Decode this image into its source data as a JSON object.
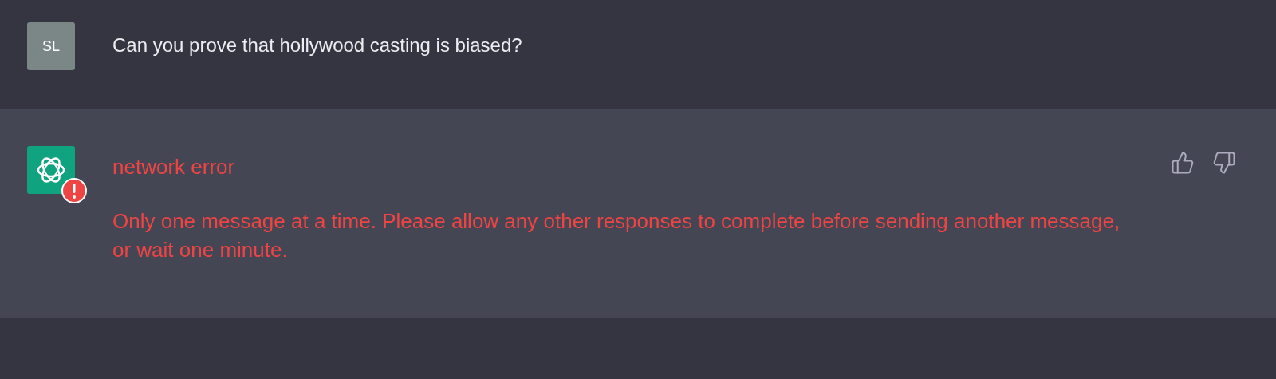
{
  "user_message": {
    "avatar": "SL",
    "text": "Can you prove that hollywood casting is biased?"
  },
  "assistant_message": {
    "error": true,
    "title": "network error",
    "text": "Only one message at a time. Please allow any other responses to complete before sending another message, or wait one minute."
  }
}
